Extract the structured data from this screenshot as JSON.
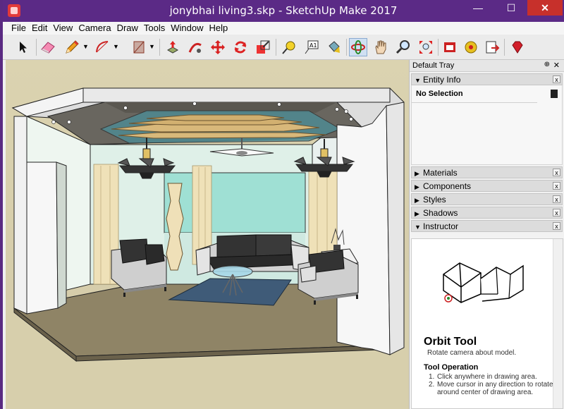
{
  "window": {
    "title": "jonybhai living3.skp - SketchUp Make 2017",
    "min_glyph": "—",
    "max_glyph": "☐",
    "close_glyph": "✕"
  },
  "menu": [
    "File",
    "Edit",
    "View",
    "Camera",
    "Draw",
    "Tools",
    "Window",
    "Help"
  ],
  "toolbar": {
    "icons": [
      "select-icon",
      "eraser-icon",
      "pencil-icon",
      "arc-icon",
      "shapes-icon",
      "push-pull-icon",
      "follow-me-icon",
      "move-icon",
      "rotate-icon",
      "scale-icon",
      "tape-measure-icon",
      "text-icon",
      "paint-bucket-icon",
      "orbit-icon",
      "pan-icon",
      "zoom-icon",
      "zoom-extents-icon",
      "warehouse-icon",
      "extension-icon",
      "share-model-icon",
      "ruby-icon"
    ],
    "active_tool": "orbit-icon"
  },
  "tray": {
    "title": "Default Tray",
    "pin_glyph": "⊕",
    "close_glyph": "✕",
    "panels": {
      "entity_info": {
        "label": "Entity Info",
        "selection": "No Selection",
        "expanded": true
      },
      "materials": {
        "label": "Materials",
        "expanded": false
      },
      "components": {
        "label": "Components",
        "expanded": false
      },
      "styles": {
        "label": "Styles",
        "expanded": false
      },
      "shadows": {
        "label": "Shadows",
        "expanded": false
      },
      "instructor": {
        "label": "Instructor",
        "expanded": true
      }
    },
    "arrow_expanded": "▼",
    "arrow_collapsed": "▶",
    "panel_close": "x"
  },
  "instructor": {
    "tool_name": "Orbit Tool",
    "tool_desc": "Rotate camera about model.",
    "operation_heading": "Tool Operation",
    "steps": [
      {
        "n": "1.",
        "text": "Click anywhere in drawing area."
      },
      {
        "n": "2.",
        "text": "Move cursor in any direction to rotate around center of drawing area."
      }
    ]
  },
  "colors": {
    "titlebar": "#5b2a86",
    "close_button": "#c7302b",
    "sky": "#dbd2b0",
    "floor": "#8f8466",
    "rug": "#3f5b78",
    "back_wall_glass": "#9fe0d4",
    "sofa": "#333333",
    "sofa_base": "#d2d2d2",
    "curtain": "#efe1b8"
  }
}
